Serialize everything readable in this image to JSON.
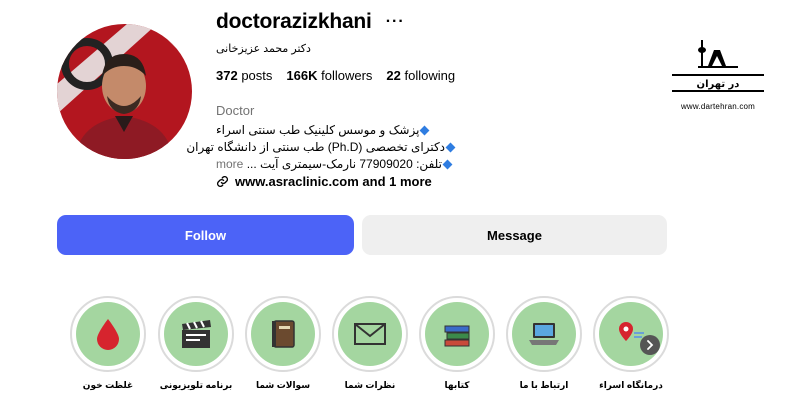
{
  "profile": {
    "username": "doctorazizkhani",
    "more_label": "···",
    "full_name": "دکتر محمد عزیزخانی",
    "stats": {
      "posts_count": "372",
      "posts_label": "posts",
      "followers_count": "166K",
      "followers_label": "followers",
      "following_count": "22",
      "following_label": "following"
    },
    "category": "Doctor",
    "bio": {
      "line1": "پزشک و موسس کلینیک طب سنتی اسراء",
      "line2": "دکترای تخصصی (Ph.D) طب سنتی از دانشگاه تهران",
      "line3_phone": "تلفن: 77909020 نارمک-سیمتری آیت",
      "line3_ellipsis": "...",
      "more_label": "more"
    },
    "link": "www.asraclinic.com and 1 more"
  },
  "actions": {
    "follow_label": "Follow",
    "message_label": "Message",
    "follow_color": "#4c63f7"
  },
  "watermark": {
    "logo_text": "در تهران",
    "url": "www.dartehran.com"
  },
  "highlights": [
    {
      "label": "غلظت خون",
      "icon": "blood-drop-icon"
    },
    {
      "label": "برنامه تلویزیونی",
      "icon": "clapperboard-icon"
    },
    {
      "label": "سوالات شما",
      "icon": "notebook-icon"
    },
    {
      "label": "نظرات شما",
      "icon": "envelope-icon"
    },
    {
      "label": "کتابها",
      "icon": "books-icon"
    },
    {
      "label": "ارتباط با ما",
      "icon": "laptop-icon"
    },
    {
      "label": "درمانگاه اسراء",
      "icon": "map-pin-icon"
    }
  ],
  "colors": {
    "highlight_bg": "#a4d6a0",
    "muted_text": "#737373"
  }
}
